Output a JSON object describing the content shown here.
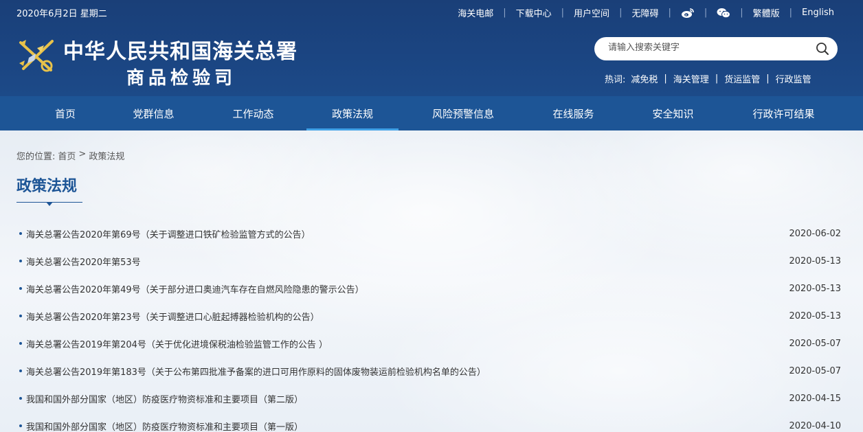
{
  "header": {
    "date": "2020年6月2日 星期二",
    "top_links": [
      "海关电邮",
      "下载中心",
      "用户空间",
      "无障碍"
    ],
    "icons": [
      "weibo-icon",
      "wechat-icon"
    ],
    "lang_links": [
      "繁體版",
      "English"
    ],
    "title_main": "中华人民共和国海关总署",
    "title_sub": "商品检验司",
    "search_placeholder": "请输入搜索关键字",
    "hot_label": "热词:",
    "hot_words": [
      "减免税",
      "海关管理",
      "货运监管",
      "行政监管"
    ]
  },
  "nav": {
    "items": [
      "首页",
      "党群信息",
      "工作动态",
      "政策法规",
      "风险预警信息",
      "在线服务",
      "安全知识",
      "行政许可结果"
    ],
    "active_index": 3
  },
  "breadcrumb": {
    "label": "您的位置:",
    "home": "首页",
    "sep": ">",
    "current": "政策法规"
  },
  "page_title": "政策法规",
  "list": [
    {
      "title": "海关总署公告2020年第69号（关于调整进口铁矿检验监管方式的公告）",
      "date": "2020-06-02"
    },
    {
      "title": "海关总署公告2020年第53号",
      "date": "2020-05-13"
    },
    {
      "title": "海关总署公告2020年第49号（关于部分进口奥迪汽车存在自燃风险隐患的警示公告）",
      "date": "2020-05-13"
    },
    {
      "title": "海关总署公告2020年第23号（关于调整进口心脏起搏器检验机构的公告）",
      "date": "2020-05-13"
    },
    {
      "title": "海关总署公告2019年第204号（关于优化进境保税油检验监管工作的公告 ）",
      "date": "2020-05-07"
    },
    {
      "title": "海关总署公告2019年第183号（关于公布第四批准予备案的进口可用作原料的固体废物装运前检验机构名单的公告）",
      "date": "2020-05-07"
    },
    {
      "title": "我国和国外部分国家（地区）防疫医疗物资标准和主要项目（第二版）",
      "date": "2020-04-15"
    },
    {
      "title": "我国和国外部分国家（地区）防疫医疗物资标准和主要项目（第一版）",
      "date": "2020-04-10"
    }
  ],
  "colors": {
    "header_bg": "#1a3f78",
    "nav_bg": "#1d5596",
    "accent": "#3fa0e6"
  }
}
